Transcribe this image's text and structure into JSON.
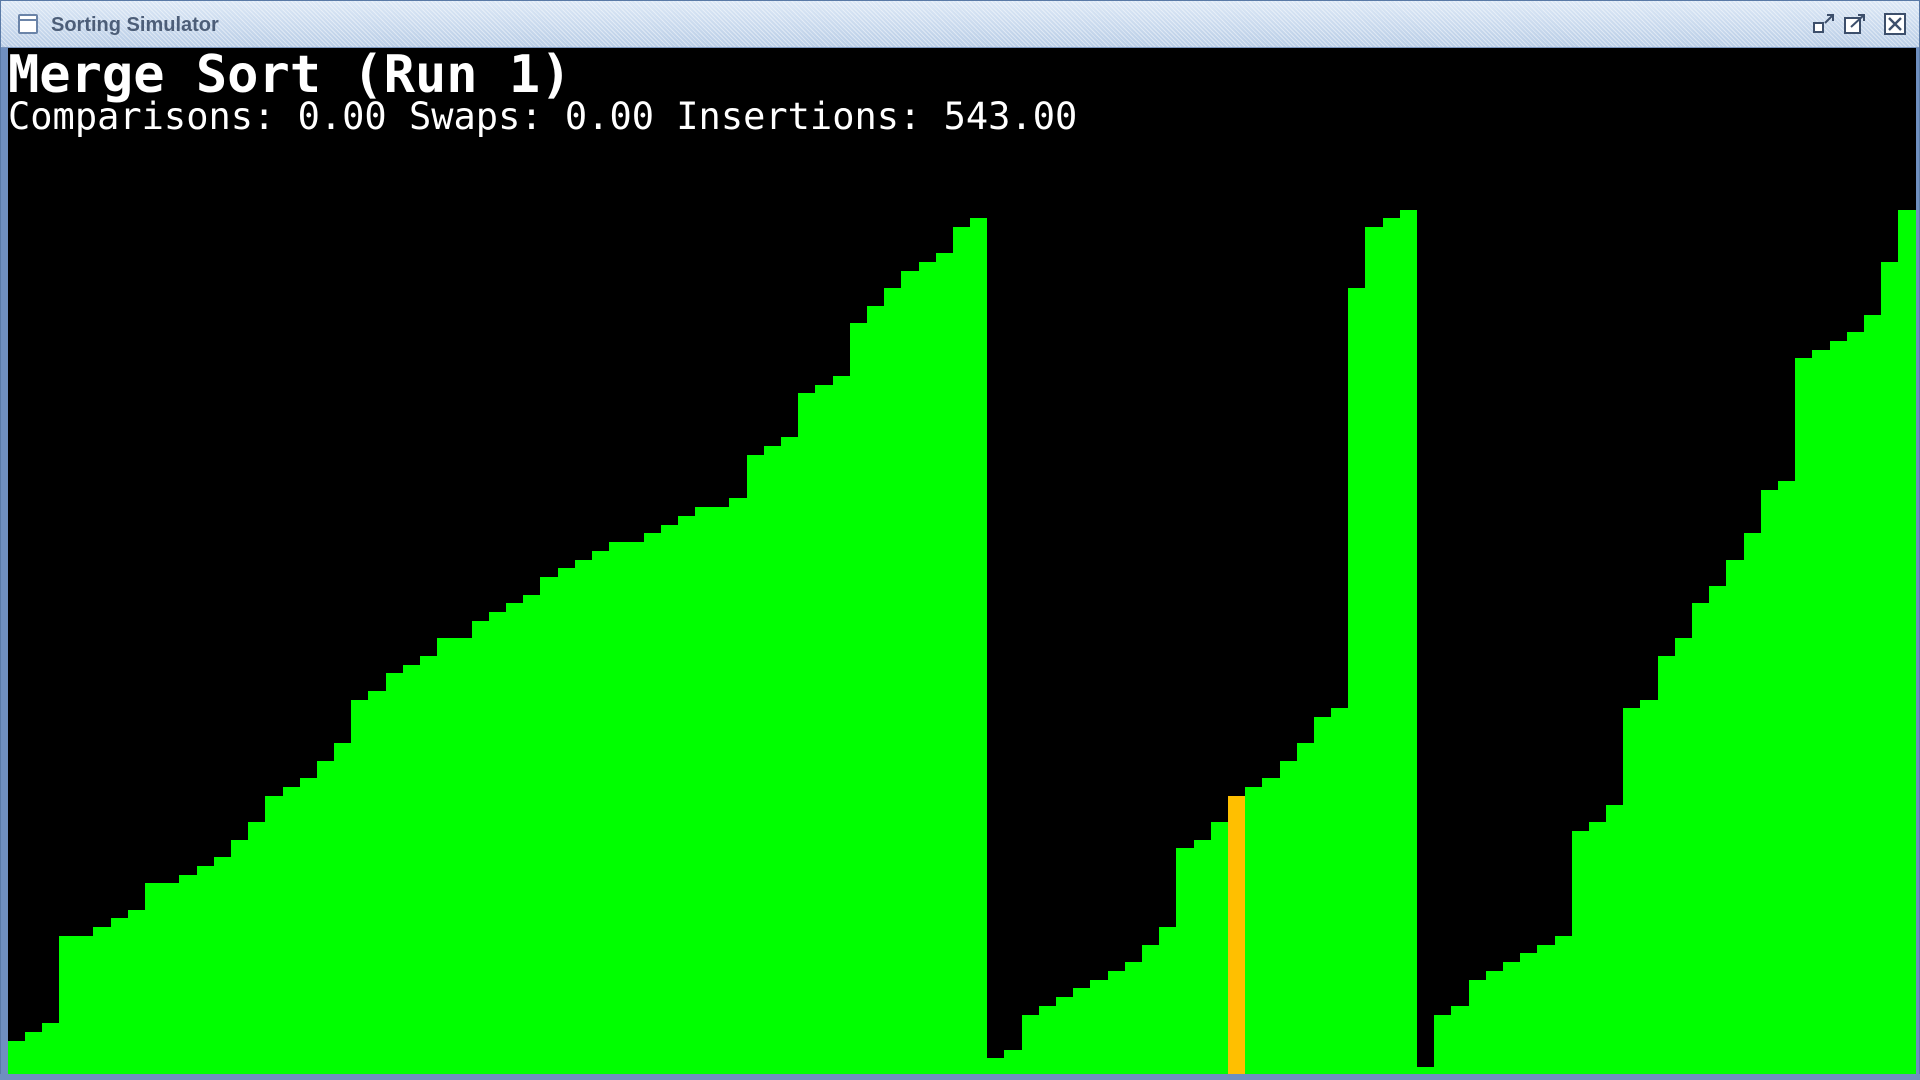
{
  "window": {
    "title": "Sorting Simulator",
    "icons": {
      "app": "window-icon",
      "restore": "restore-icon",
      "maximize": "maximize-icon",
      "close": "close-icon"
    }
  },
  "header": {
    "title": "Merge Sort (Run 1)",
    "stats": "Comparisons: 0.00 Swaps: 0.00 Insertions: 543.00"
  },
  "colors": {
    "bar": "#00ff00",
    "highlight": "#ffbf00",
    "background": "#000000"
  },
  "bars": {
    "max_value": 100,
    "highlight_index": 71,
    "values": [
      3,
      4,
      5,
      15,
      15,
      16,
      17,
      18,
      21,
      21,
      22,
      23,
      24,
      26,
      28,
      31,
      32,
      33,
      35,
      37,
      42,
      43,
      45,
      46,
      47,
      49,
      49,
      51,
      52,
      53,
      54,
      56,
      57,
      58,
      59,
      60,
      60,
      61,
      62,
      63,
      64,
      64,
      65,
      70,
      71,
      72,
      77,
      78,
      79,
      85,
      87,
      89,
      91,
      92,
      93,
      96,
      97,
      1,
      2,
      6,
      7,
      8,
      9,
      10,
      11,
      12,
      14,
      16,
      25,
      26,
      28,
      31,
      32,
      33,
      35,
      37,
      40,
      41,
      89,
      96,
      97,
      98,
      0,
      6,
      7,
      10,
      11,
      12,
      13,
      14,
      15,
      27,
      28,
      30,
      41,
      42,
      47,
      49,
      53,
      55,
      58,
      61,
      66,
      67,
      81,
      82,
      83,
      84,
      86,
      92,
      98
    ]
  }
}
